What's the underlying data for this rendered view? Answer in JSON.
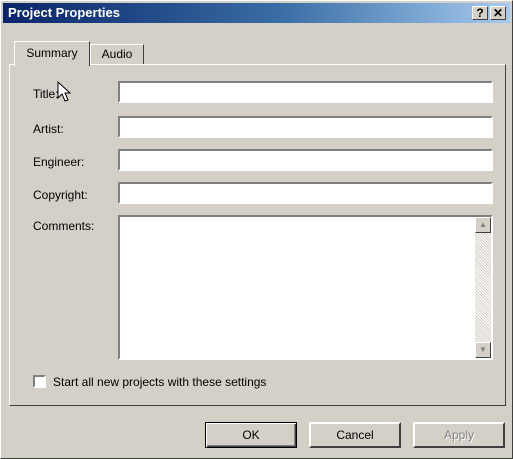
{
  "window": {
    "title": "Project Properties",
    "help_glyph": "?",
    "close_glyph": "✕"
  },
  "tabs": [
    {
      "label": "Summary",
      "active": true
    },
    {
      "label": "Audio",
      "active": false
    }
  ],
  "fields": {
    "title": {
      "label": "Title:",
      "value": ""
    },
    "artist": {
      "label": "Artist:",
      "value": ""
    },
    "engineer": {
      "label": "Engineer:",
      "value": ""
    },
    "copyright": {
      "label": "Copyright:",
      "value": ""
    },
    "comments": {
      "label": "Comments:",
      "value": ""
    }
  },
  "scroll_up_glyph": "▲",
  "scroll_down_glyph": "▼",
  "checkbox": {
    "label": "Start all new projects with these settings",
    "checked": false
  },
  "buttons": {
    "ok": "OK",
    "cancel": "Cancel",
    "apply": "Apply"
  }
}
